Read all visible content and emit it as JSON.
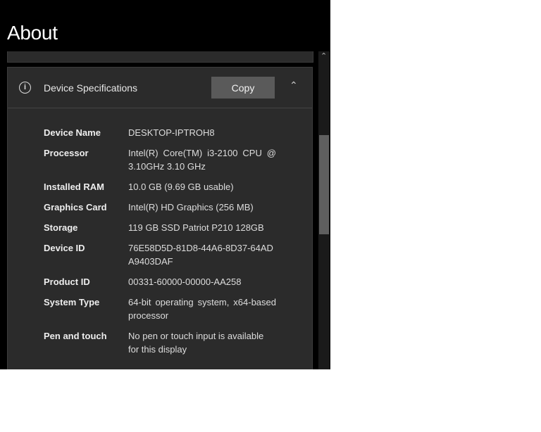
{
  "title": "About",
  "section": {
    "title": "Device Specifications",
    "copy_label": "Copy"
  },
  "specs": [
    {
      "label": "Device Name",
      "value": "DESKTOP-IPTROH8"
    },
    {
      "label": "Processor",
      "value": "Intel(R) Core(TM) i3-2100 CPU @ 3.10GHz   3.10 GHz"
    },
    {
      "label": "Installed RAM",
      "value": "10.0 GB (9.69 GB usable)"
    },
    {
      "label": "Graphics Card",
      "value": "Intel(R) HD Graphics (256 MB)"
    },
    {
      "label": "Storage",
      "value": "119 GB SSD Patriot P210 128GB"
    },
    {
      "label": "Device ID",
      "value": "76E58D5D-81D8-44A6-8D37-64ADA9403DAF"
    },
    {
      "label": "Product ID",
      "value": "00331-60000-00000-AA258"
    },
    {
      "label": "System Type",
      "value": "64-bit operating system, x64-based processor"
    },
    {
      "label": "Pen and touch",
      "value": "No pen or touch input is available for this display"
    }
  ]
}
